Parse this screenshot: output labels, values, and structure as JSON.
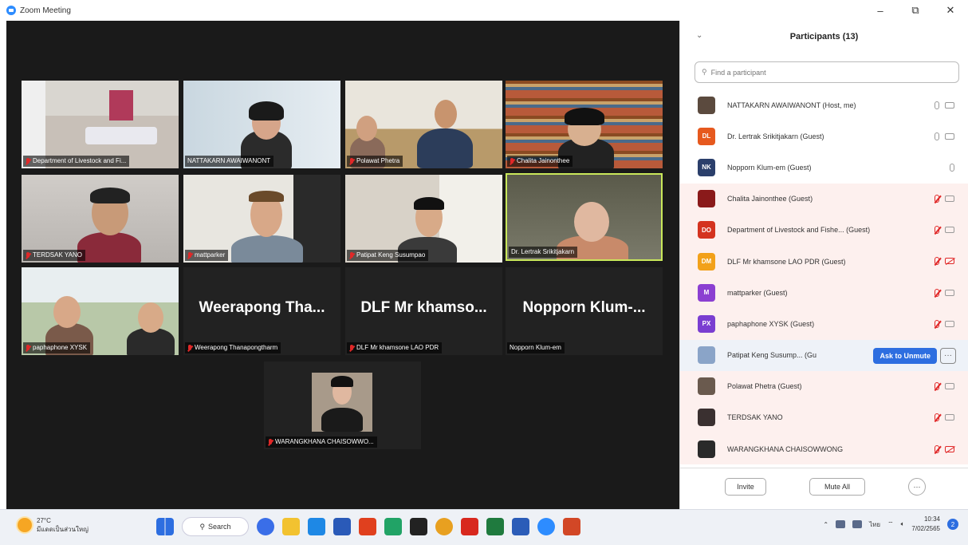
{
  "app": {
    "title": "Zoom Meeting"
  },
  "window_controls": {
    "minimize": "–",
    "restore": "⧉",
    "close": "✕"
  },
  "tiles": [
    {
      "label": "Department of Livestock and Fi...",
      "muted": true
    },
    {
      "label": "NATTAKARN AWAIWANONT",
      "muted": false
    },
    {
      "label": "Polawat Phetra",
      "muted": true
    },
    {
      "label": "Chalita Jainonthee",
      "muted": true
    },
    {
      "label": "TERDSAK YANO",
      "muted": true
    },
    {
      "label": "mattparker",
      "muted": true
    },
    {
      "label": "Patipat Keng Susumpao",
      "muted": true
    },
    {
      "label": "Dr. Lertrak Srikitjakarn",
      "muted": false
    },
    {
      "label": "paphaphone XYSK",
      "muted": true
    },
    {
      "label": "Weerapong Thanapongtharm",
      "muted": true,
      "bigname": "Weerapong  Tha..."
    },
    {
      "label": "DLF Mr khamsone LAO PDR",
      "muted": true,
      "bigname": "DLF  Mr  khamso..."
    },
    {
      "label": "Nopporn Klum-em",
      "muted": false,
      "bigname": "Nopporn  Klum-..."
    },
    {
      "label": "WARANGKHANA CHAISOWWO...",
      "muted": true
    }
  ],
  "panel": {
    "title": "Participants (13)",
    "search_placeholder": "Find a participant",
    "participants": [
      {
        "initials": "",
        "color": "#5b4a3e",
        "name": "NATTAKARN AWAIWANONT (Host, me)",
        "mic": "on",
        "cam": "on"
      },
      {
        "initials": "DL",
        "color": "#e6591e",
        "name": "Dr. Lertrak Srikitjakarn (Guest)",
        "mic": "on",
        "cam": "on"
      },
      {
        "initials": "NK",
        "color": "#2b3f6b",
        "name": "Nopporn Klum-em (Guest)",
        "mic": "on",
        "cam": "none"
      },
      {
        "initials": "",
        "color": "#8a1a1a",
        "name": "Chalita Jainonthee (Guest)",
        "mic": "muted",
        "cam": "on"
      },
      {
        "initials": "DO",
        "color": "#d4331f",
        "name": "Department of Livestock and Fishe... (Guest)",
        "mic": "muted",
        "cam": "on"
      },
      {
        "initials": "DM",
        "color": "#f2a11a",
        "name": "DLF Mr khamsone LAO PDR (Guest)",
        "mic": "muted",
        "cam": "off"
      },
      {
        "initials": "M",
        "color": "#8b3fd1",
        "name": "mattparker (Guest)",
        "mic": "muted",
        "cam": "on"
      },
      {
        "initials": "PX",
        "color": "#7a3ed1",
        "name": "paphaphone XYSK (Guest)",
        "mic": "muted",
        "cam": "on"
      },
      {
        "initials": "",
        "color": "#8aa4c8",
        "name": "Patipat Keng Susump... (Gu",
        "mic": "muted",
        "cam": "on",
        "action": "Ask to Unmute",
        "more": "···"
      },
      {
        "initials": "",
        "color": "#6a5a4e",
        "name": "Polawat Phetra (Guest)",
        "mic": "muted",
        "cam": "on"
      },
      {
        "initials": "",
        "color": "#3a3030",
        "name": "TERDSAK YANO",
        "mic": "muted",
        "cam": "on"
      },
      {
        "initials": "",
        "color": "#2a2a2a",
        "name": "WARANGKHANA CHAISOWWONG",
        "mic": "muted",
        "cam": "off"
      }
    ],
    "footer": {
      "invite": "Invite",
      "mute_all": "Mute All",
      "more": "···"
    }
  },
  "taskbar": {
    "weather_temp": "27°C",
    "weather_desc": "มีแดดเป็นส่วนใหญ่",
    "search_label": "Search",
    "clock_time": "10:34",
    "clock_date": "7/02/2565",
    "lang": "ไทย",
    "notifications": "2"
  }
}
